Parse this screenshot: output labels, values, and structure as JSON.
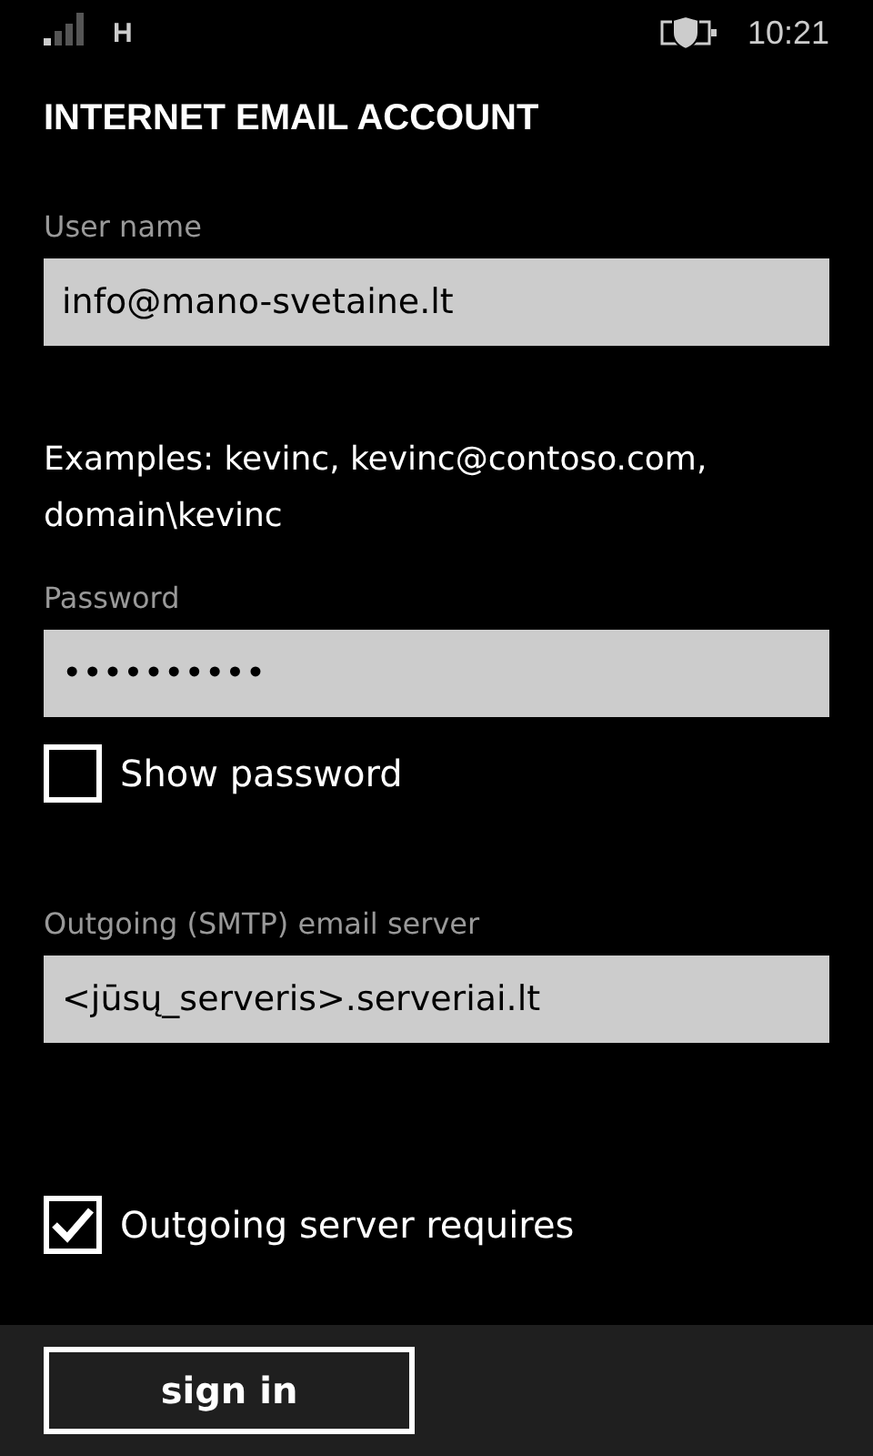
{
  "status_bar": {
    "network": "H",
    "time": "10:21"
  },
  "title": "INTERNET EMAIL ACCOUNT",
  "items": [
    {
      "kind": "field",
      "label": "User name",
      "value": "info@mano-svetaine.lt"
    },
    {
      "kind": "note",
      "text": "Examples: kevinc, kevinc@contoso.com, domain\\kevinc"
    },
    {
      "kind": "field",
      "label": "Password",
      "value": "••••••••••"
    },
    {
      "kind": "checkbox",
      "label": "Show password",
      "checked": false
    },
    {
      "kind": "field",
      "label": "Outgoing (SMTP) email server",
      "value": "<jūsų_serveris>.serveriai.lt"
    },
    {
      "kind": "checkbox",
      "label": "Outgoing server requires",
      "checked": true
    }
  ],
  "app_bar": {
    "button": "sign in"
  }
}
